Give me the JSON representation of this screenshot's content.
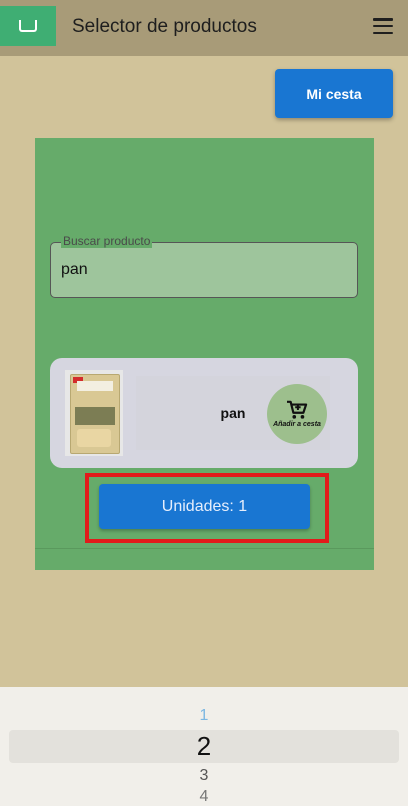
{
  "header": {
    "title": "Selector de productos",
    "logo_icon": "cart-logo-icon",
    "menu_icon": "hamburger-menu-icon"
  },
  "actions": {
    "basket_label": "Mi cesta"
  },
  "search": {
    "label": "Buscar producto",
    "value": "pan"
  },
  "product": {
    "name": "pan",
    "add_label": "Añadir a cesta",
    "image_icon": "bread-bag-image"
  },
  "units": {
    "label": "Unidades: 1"
  },
  "picker": {
    "options": [
      "1",
      "2",
      "3",
      "4"
    ],
    "selected": "2"
  },
  "colors": {
    "accent": "#1976d2",
    "panel": "#66ab6a",
    "background": "#d1c39a",
    "highlight": "#e11b1b"
  }
}
